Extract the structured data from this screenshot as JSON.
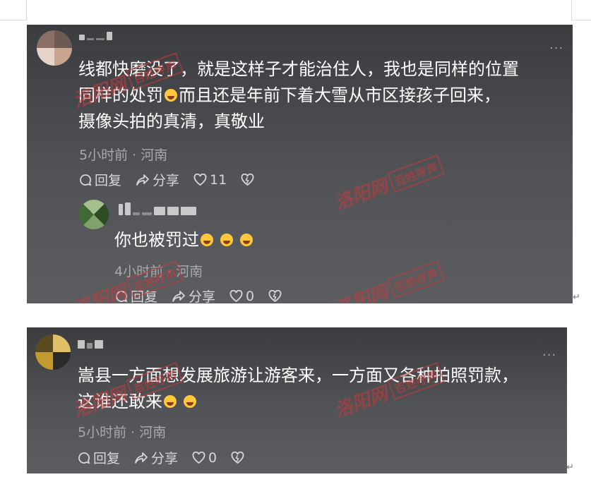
{
  "page": {
    "return_mark": "↵"
  },
  "watermark": {
    "script": "洛阳网",
    "box": "百姓呼声"
  },
  "card1": {
    "comment": {
      "line1": "线都快磨没了，就是这样子才能治住人，我也是同样的位置",
      "line2_before": "同样的处罚",
      "line2_after": "而且还是年前下着大雪从市区接孩子回来，",
      "line3": "摄像头拍的真清，真敬业",
      "meta": "5小时前 · 河南",
      "reply": "回复",
      "share": "分享",
      "likes": "11",
      "more": "..."
    },
    "reply": {
      "text": "你也被罚过",
      "meta": "4小时前 · 河南",
      "reply": "回复",
      "share": "分享",
      "likes": "0"
    }
  },
  "card2": {
    "comment": {
      "line1": "嵩县一方面想发展旅游让游客来，一方面又各种拍照罚款，",
      "line2": "这谁还敢来",
      "meta": "5小时前 · 河南",
      "reply": "回复",
      "share": "分享",
      "likes": "0",
      "more": "..."
    }
  },
  "colors": {
    "card_top": "#3b3c3f",
    "card_bottom": "#5b5d61",
    "watermark": "#c83b3b",
    "meta_text": "#a7a9ad"
  }
}
